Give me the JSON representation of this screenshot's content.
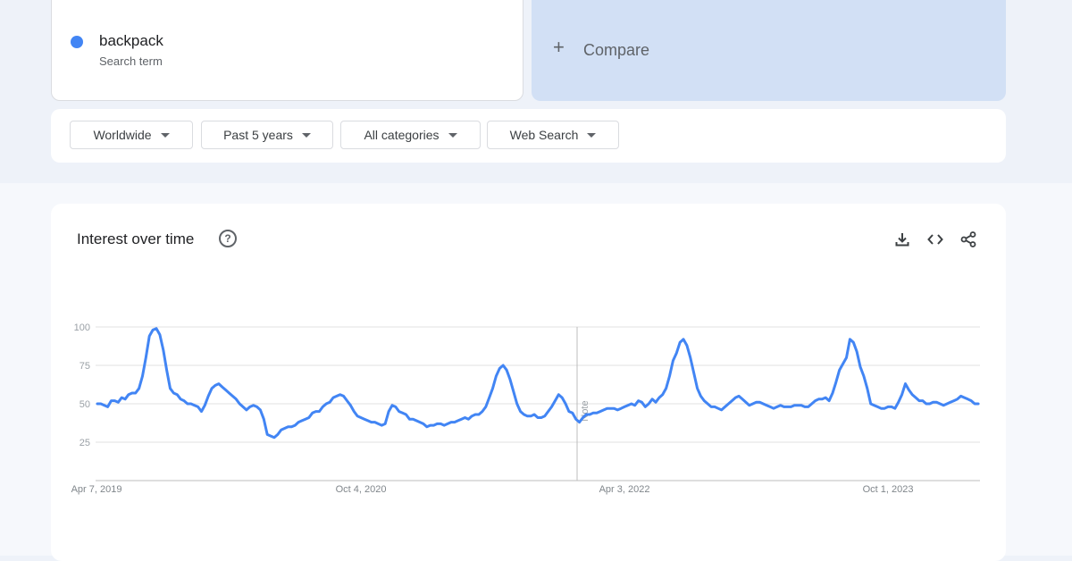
{
  "search_term": {
    "name": "backpack",
    "subtitle": "Search term",
    "color": "#4285f4"
  },
  "compare": {
    "icon": "plus-icon",
    "label": "Compare"
  },
  "filters": [
    {
      "label": "Worldwide"
    },
    {
      "label": "Past 5 years"
    },
    {
      "label": "All categories"
    },
    {
      "label": "Web Search"
    }
  ],
  "card": {
    "title": "Interest over time",
    "help_icon": "help-icon",
    "actions": [
      "download-icon",
      "embed-code-icon",
      "share-icon"
    ],
    "note_label": "Note"
  },
  "chart_data": {
    "type": "line",
    "ylim": [
      0,
      100
    ],
    "y_ticks": [
      25,
      50,
      75,
      100
    ],
    "x_ticks": [
      "Apr 7, 2019",
      "Oct 4, 2020",
      "Apr 3, 2022",
      "Oct 1, 2023"
    ],
    "grid": true,
    "series": [
      {
        "color": "#4285f4",
        "values": [
          50,
          50,
          49,
          48,
          52,
          52,
          51,
          54,
          53,
          56,
          57,
          57,
          60,
          68,
          80,
          94,
          98,
          99,
          95,
          85,
          72,
          60,
          57,
          56,
          53,
          52,
          50,
          50,
          49,
          48,
          45,
          49,
          55,
          60,
          62,
          63,
          61,
          59,
          57,
          55,
          53,
          50,
          48,
          46,
          48,
          49,
          48,
          46,
          40,
          30,
          29,
          28,
          30,
          33,
          34,
          35,
          35,
          36,
          38,
          39,
          40,
          41,
          44,
          45,
          45,
          48,
          50,
          51,
          54,
          55,
          56,
          55,
          52,
          49,
          45,
          42,
          41,
          40,
          39,
          38,
          38,
          37,
          36,
          37,
          45,
          49,
          48,
          45,
          44,
          43,
          40,
          40,
          39,
          38,
          37,
          35,
          36,
          36,
          37,
          37,
          36,
          37,
          38,
          38,
          39,
          40,
          41,
          40,
          42,
          43,
          43,
          45,
          48,
          54,
          60,
          68,
          73,
          75,
          72,
          66,
          58,
          50,
          45,
          43,
          42,
          42,
          43,
          41,
          41,
          42,
          45,
          48,
          52,
          56,
          54,
          50,
          45,
          44,
          40,
          38,
          41,
          43,
          43,
          44,
          44,
          45,
          46,
          47,
          47,
          47,
          46,
          47,
          48,
          49,
          50,
          49,
          52,
          51,
          48,
          50,
          53,
          51,
          54,
          56,
          60,
          68,
          78,
          83,
          90,
          92,
          88,
          80,
          70,
          60,
          55,
          52,
          50,
          48,
          48,
          47,
          46,
          48,
          50,
          52,
          54,
          55,
          53,
          51,
          49,
          50,
          51,
          51,
          50,
          49,
          48,
          47,
          48,
          49,
          48,
          48,
          48,
          49,
          49,
          49,
          48,
          48,
          50,
          52,
          53,
          53,
          54,
          52,
          57,
          64,
          72,
          76,
          80,
          92,
          90,
          84,
          74,
          68,
          60,
          50,
          49,
          48,
          47,
          47,
          48,
          48,
          47,
          51,
          56,
          63,
          59,
          56,
          54,
          52,
          52,
          50,
          50,
          51,
          51,
          50,
          49,
          50,
          51,
          52,
          53,
          55,
          54,
          53,
          52,
          50,
          50
        ]
      }
    ]
  }
}
